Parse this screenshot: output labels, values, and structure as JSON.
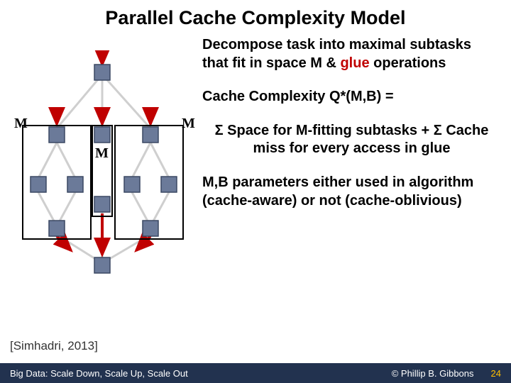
{
  "title": "Parallel Cache Complexity Model",
  "text": {
    "decompose_pre": "Decompose task into maximal subtasks that fit in space M & ",
    "glue_word": "glue",
    "decompose_post": " operations",
    "cache_line": "Cache Complexity Q*(M,B) =",
    "sigma": "Σ Space for M-fitting subtasks + Σ Cache miss for every access in glue",
    "params": "M,B parameters either used in algorithm (cache-aware) or not (cache-oblivious)"
  },
  "labels": {
    "m1": "M",
    "m2": "M",
    "m3": "M"
  },
  "citation": "[Simhadri, 2013]",
  "footer": {
    "left": "Big Data: Scale Down, Scale Up, Scale Out",
    "right": "© Phillip B. Gibbons",
    "page": "24"
  },
  "colors": {
    "node": "#6b7a99",
    "node_border": "#3b4863",
    "edge": "#d8d8d8",
    "arrow": "#c00000",
    "box": "#000"
  }
}
